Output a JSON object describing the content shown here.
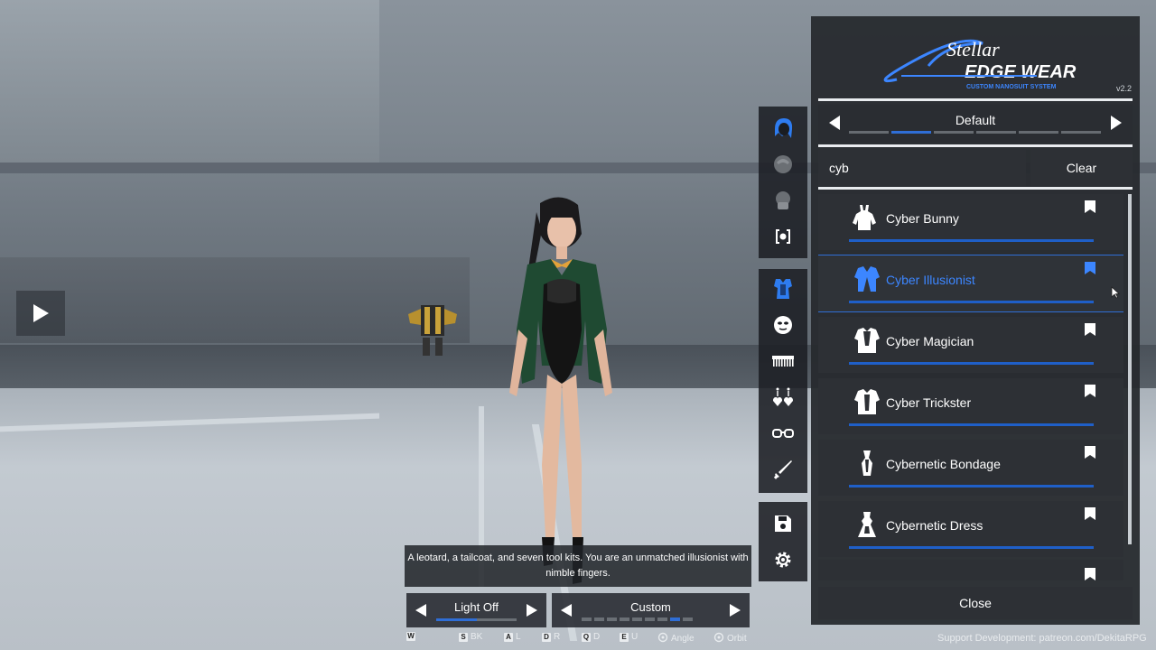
{
  "logo": {
    "script": "Stellar",
    "brand": "EDGE WEAR",
    "tagline": "CUSTOM NANOSUIT SYSTEM",
    "version": "v2.2"
  },
  "preset": {
    "name": "Default",
    "segments": 6,
    "active_segment": 2
  },
  "search": {
    "value": "cyb"
  },
  "clear_label": "Clear",
  "outfits": [
    {
      "label": "Cyber Bunny",
      "icon": "bunny-suit-icon",
      "bookmarked": false,
      "selected": false
    },
    {
      "label": "Cyber Illusionist",
      "icon": "tailcoat-icon",
      "bookmarked": true,
      "selected": true
    },
    {
      "label": "Cyber Magician",
      "icon": "magician-suit-icon",
      "bookmarked": false,
      "selected": false
    },
    {
      "label": "Cyber Trickster",
      "icon": "trickster-suit-icon",
      "bookmarked": false,
      "selected": false
    },
    {
      "label": "Cybernetic Bondage",
      "icon": "bondage-suit-icon",
      "bookmarked": false,
      "selected": false
    },
    {
      "label": "Cybernetic Dress",
      "icon": "dress-icon",
      "bookmarked": false,
      "selected": false
    }
  ],
  "close_label": "Close",
  "support_text": "Support Development: patreon.com/DekitaRPG",
  "description": "A leotard, a tailcoat, and seven tool kits. You are an unmatched illusionist with nimble fingers.",
  "light": {
    "label": "Light Off",
    "level": 0.5
  },
  "camera": {
    "label": "Custom",
    "segments": 9,
    "active_segment": 8
  },
  "keys": [
    {
      "key": "W",
      "label": ""
    },
    {
      "key": "S",
      "label": "BK"
    },
    {
      "key": "A",
      "label": "L"
    },
    {
      "key": "D",
      "label": "R"
    },
    {
      "key": "Q",
      "label": "D"
    },
    {
      "key": "E",
      "label": "U"
    },
    {
      "key": "",
      "label": "Angle"
    },
    {
      "key": "",
      "label": "Orbit"
    }
  ],
  "icon_bar": {
    "top": [
      "hair-blue-icon",
      "hair-icon",
      "face-mask-icon",
      "adapter-icon"
    ],
    "middle": [
      "suit-icon",
      "mask-icon",
      "comb-icon",
      "earrings-icon",
      "glasses-icon",
      "sword-icon"
    ],
    "bottom": [
      "save-icon",
      "gear-icon"
    ]
  },
  "colors": {
    "accent": "#2f6ed6",
    "accent_text": "#3c86ff",
    "panel": "#2d3035",
    "panel_dark": "#26292e"
  }
}
